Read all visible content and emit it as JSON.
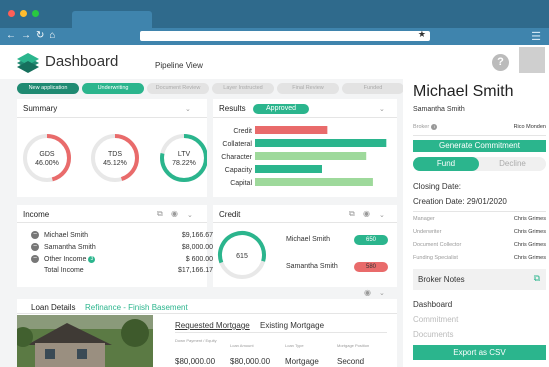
{
  "colors": {
    "accent": "#2bb58d",
    "dark_accent": "#1f8a72",
    "danger": "#e96b6b",
    "light_green": "#9ed99b"
  },
  "header": {
    "title": "Dashboard",
    "subtitle": "Pipeline View",
    "help_icon": "?"
  },
  "stages": [
    {
      "label": "New application",
      "state": "done",
      "w": 62
    },
    {
      "label": "Underwriting",
      "state": "active",
      "w": 62
    },
    {
      "label": "Document Review",
      "state": "todo",
      "w": 62
    },
    {
      "label": "Layer Instructed",
      "state": "todo",
      "w": 62
    },
    {
      "label": "Final Review",
      "state": "todo",
      "w": 62
    },
    {
      "label": "Funded",
      "state": "todo",
      "w": 62
    }
  ],
  "summary": {
    "title": "Summary",
    "gauges": [
      {
        "label": "GDS",
        "value_text": "46.00%",
        "fraction": 0.46,
        "color": "#e96b6b"
      },
      {
        "label": "TDS",
        "value_text": "45.12%",
        "fraction": 0.4512,
        "color": "#e96b6b"
      },
      {
        "label": "LTV",
        "value_text": "78.22%",
        "fraction": 0.7822,
        "color": "#2bb58d"
      }
    ]
  },
  "results": {
    "title": "Results",
    "status": "Approved",
    "bars": [
      {
        "label": "Credit",
        "fraction": 0.54,
        "color": "#e96b6b"
      },
      {
        "label": "Collateral",
        "fraction": 0.98,
        "color": "#2bb58d"
      },
      {
        "label": "Character",
        "fraction": 0.83,
        "color": "#9ed99b"
      },
      {
        "label": "Capacity",
        "fraction": 0.5,
        "color": "#2bb58d"
      },
      {
        "label": "Capital",
        "fraction": 0.88,
        "color": "#9ed99b"
      }
    ]
  },
  "income": {
    "title": "Income",
    "rows": [
      {
        "name": "Michael Smith",
        "value": "$9,166.67"
      },
      {
        "name": "Samantha Smith",
        "value": "$8,000.00"
      },
      {
        "name": "Other Income",
        "value": "$ 600.00",
        "badge": "3"
      }
    ],
    "total_label": "Total Income",
    "total_value": "$17,166.17"
  },
  "credit": {
    "title": "Credit",
    "score": "615",
    "score_fraction": 0.6,
    "borrowers": [
      {
        "name": "Michael Smith",
        "score": "650",
        "color": "#2bb58d"
      },
      {
        "name": "Samantha Smith",
        "score": "580",
        "color": "#e96b6b"
      }
    ]
  },
  "loan": {
    "title": "Loan Details",
    "subtitle": "Refinance - Finish Basement",
    "tabs": [
      "Requested Mortgage",
      "Existing Mortgage"
    ],
    "fields": [
      {
        "label": "Down Payment / Equity",
        "value": "$80,000.00"
      },
      {
        "label": "Loan Amount",
        "value": "$80,000.00"
      },
      {
        "label": "Loan Type",
        "value": "Mortgage"
      },
      {
        "label": "Mortgage Position",
        "value": "Second"
      }
    ]
  },
  "sidebar": {
    "name": "Michael Smith",
    "co_borrower": "Samantha Smith",
    "broker_label": "Broker",
    "broker_value": "Rico Monden",
    "generate_label": "Generate Commitment",
    "fund_label": "Fund",
    "decline_label": "Decline",
    "closing_date": "Closing Date:",
    "creation_date": "Creation Date: 29/01/2020",
    "roles": [
      {
        "role": "Manager",
        "name": "Chris Grimes"
      },
      {
        "role": "Underwriter",
        "name": "Chris Grimes"
      },
      {
        "role": "Document Collector",
        "name": "Chris Grimes"
      },
      {
        "role": "Funding Specialist",
        "name": "Chris Grimes"
      }
    ],
    "broker_notes": "Broker Notes",
    "nav": [
      "Dashboard",
      "Commitment",
      "Documents"
    ],
    "export_label": "Export as CSV"
  }
}
